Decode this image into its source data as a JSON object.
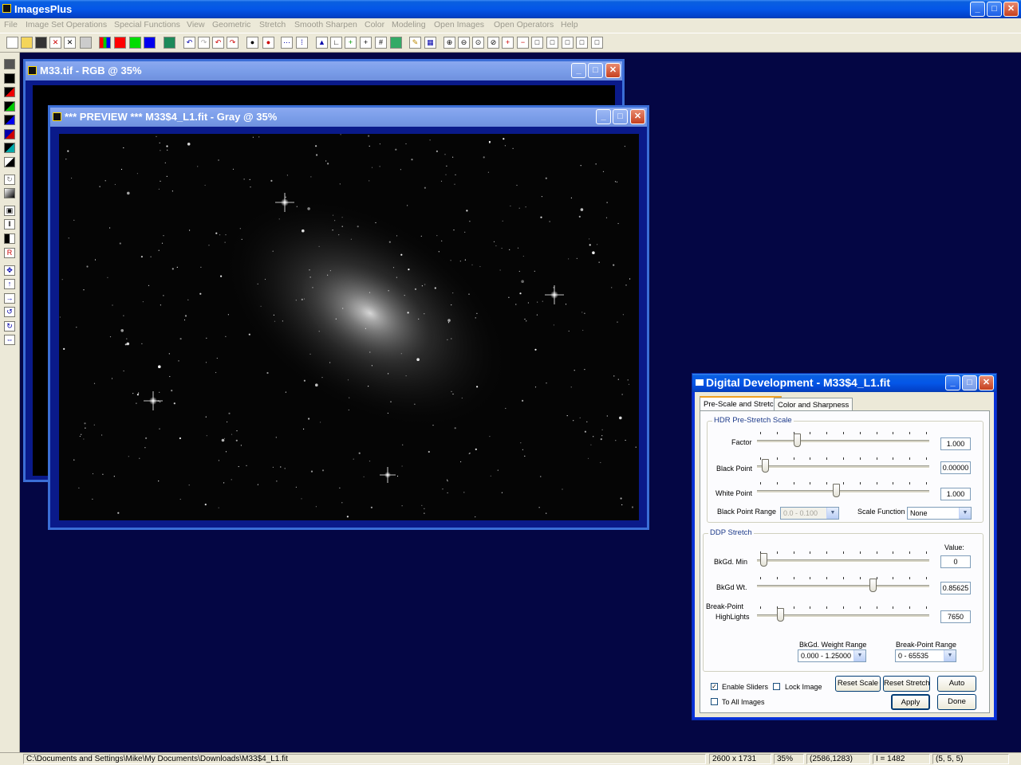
{
  "app": {
    "title": "ImagesPlus"
  },
  "menu": [
    "File",
    "Image Set Operations",
    "Special Functions",
    "View",
    "Geometric",
    "Stretch",
    "Smooth Sharpen",
    "Color",
    "Modeling",
    "Open Images",
    "Open Operators",
    "Help"
  ],
  "windows": {
    "back": {
      "title": "M33.tif - RGB @ 35%"
    },
    "front": {
      "title": "*** PREVIEW *** M33$4_L1.fit - Gray @ 35%"
    }
  },
  "dialog": {
    "title": "Digital Development - M33$4_L1.fit",
    "tabs": [
      "Pre-Scale and Stretch",
      "Color and Sharpness"
    ],
    "hdr": {
      "title": "HDR Pre-Stretch Scale",
      "factor": {
        "label": "Factor",
        "value": "1.000",
        "pos": 0.22
      },
      "black_point": {
        "label": "Black Point",
        "value": "0.00000",
        "pos": 0.03
      },
      "white_point": {
        "label": "White Point",
        "value": "1.000",
        "pos": 0.46
      },
      "black_point_range": {
        "label": "Black Point Range",
        "value": "0.0 - 0.100"
      },
      "scale_function": {
        "label": "Scale Function",
        "value": "None"
      }
    },
    "ddp": {
      "title": "DDP Stretch",
      "value_label": "Value:",
      "bkgd_min": {
        "label": "BkGd. Min",
        "value": "0",
        "pos": 0.02
      },
      "bkgd_wt": {
        "label": "BkGd Wt.",
        "value": "0.85625",
        "pos": 0.68
      },
      "break_point": {
        "label1": "Break-Point",
        "label2": "HighLights",
        "value": "7650",
        "pos": 0.12
      },
      "bkgd_weight_range": {
        "label": "BkGd. Weight Range",
        "value": "0.000 - 1.25000"
      },
      "break_point_range": {
        "label": "Break-Point Range",
        "value": "0 - 65535"
      }
    },
    "enable_sliders": "Enable Sliders",
    "lock_image": "Lock Image",
    "to_all_images": "To All Images",
    "buttons": {
      "reset_scale": "Reset Scale",
      "reset_stretch": "Reset Stretch",
      "auto": "Auto",
      "apply": "Apply",
      "done": "Done"
    }
  },
  "status": {
    "path": "C:\\Documents and Settings\\Mike\\My Documents\\Downloads\\M33$4_L1.fit",
    "dims": "2600 x 1731",
    "zoom": "35%",
    "coords": "(2586,1283)",
    "intensity": "I = 1482",
    "rgb": "(5, 5, 5)"
  },
  "colors": {
    "desktop": "#040644",
    "titlebar": "#0456e8",
    "dialog_bg": "#ece9d8"
  }
}
